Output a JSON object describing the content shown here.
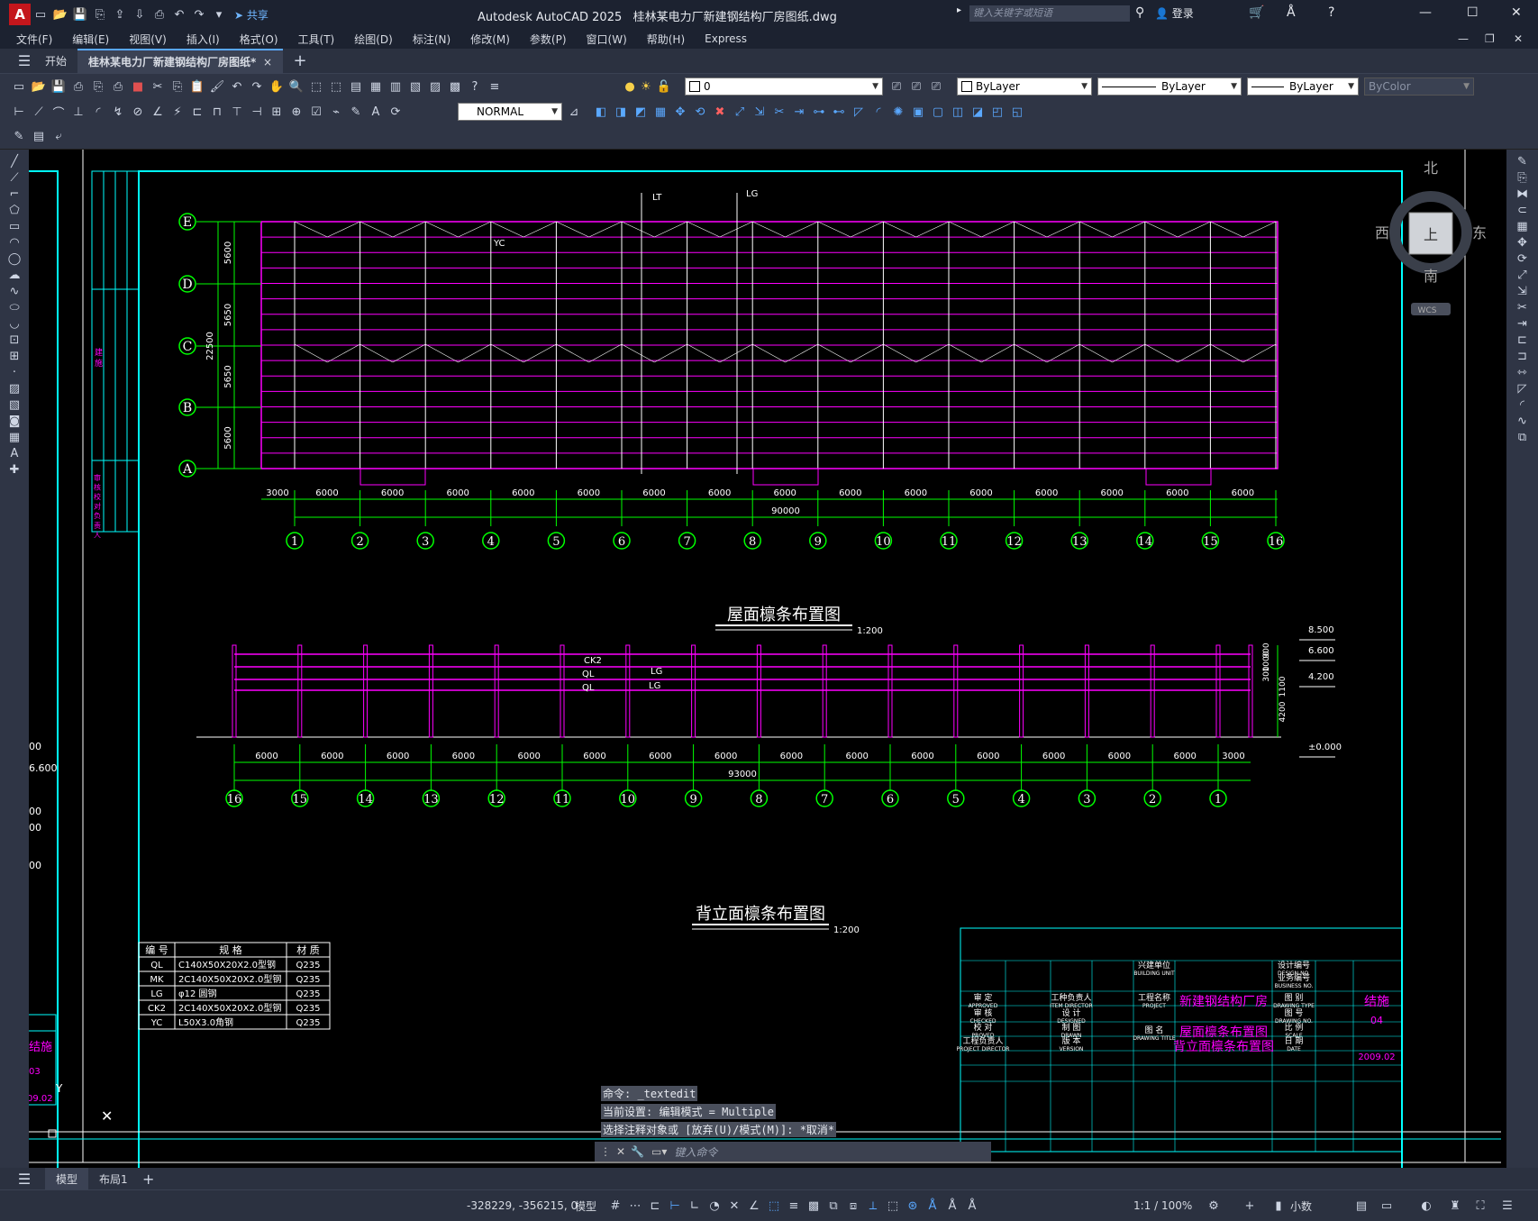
{
  "app": {
    "title": "Autodesk AutoCAD 2025",
    "file": "桂林某电力厂新建钢结构厂房图纸.dwg",
    "share": "共享",
    "search_placeholder": "键入关键字或短语",
    "login": "登录",
    "logo": "A"
  },
  "menu": [
    "文件(F)",
    "编辑(E)",
    "视图(V)",
    "插入(I)",
    "格式(O)",
    "工具(T)",
    "绘图(D)",
    "标注(N)",
    "修改(M)",
    "参数(P)",
    "窗口(W)",
    "帮助(H)",
    "Express"
  ],
  "doc_tabs": {
    "start": "开始",
    "active": "桂林某电力厂新建钢结构厂房图纸*",
    "close": "×",
    "add": "+"
  },
  "props": {
    "layer": "0",
    "color": "ByLayer",
    "linetype": "ByLayer",
    "lineweight": "ByLayer",
    "plotstyle": "ByColor",
    "dimstyle": "NORMAL"
  },
  "viewcube": {
    "north": "北",
    "south": "南",
    "east": "东",
    "west": "西",
    "face": "上",
    "wcs": "WCS"
  },
  "plan": {
    "title": "屋面檩条布置图",
    "scale": "1:200",
    "rows": [
      "E",
      "D",
      "C",
      "B",
      "A"
    ],
    "row_dims": [
      "5600",
      "5650",
      "5650",
      "5600"
    ],
    "total_row": "22500",
    "cols": [
      "1",
      "2",
      "3",
      "4",
      "5",
      "6",
      "7",
      "8",
      "9",
      "10",
      "11",
      "12",
      "13",
      "14",
      "15",
      "16"
    ],
    "first_span": "3000",
    "span": "6000",
    "total": "90000",
    "labels": {
      "lt": "LT",
      "lg": "LG",
      "yc": "YC"
    }
  },
  "elev": {
    "title": "背立面檩条布置图",
    "scale": "1:200",
    "cols": [
      "16",
      "15",
      "14",
      "13",
      "12",
      "11",
      "10",
      "9",
      "8",
      "7",
      "6",
      "5",
      "4",
      "3",
      "2",
      "1"
    ],
    "span": "6000",
    "last_span": "3000",
    "total": "93000",
    "levels": [
      "8.500",
      "6.600",
      "4.200",
      "±0.000"
    ],
    "vdims": [
      "900",
      "1000",
      "300",
      "1100",
      "4200"
    ],
    "labels": {
      "ck2": "CK2",
      "ql1": "QL",
      "ql2": "QL",
      "lg1": "LG",
      "lg2": "LG"
    }
  },
  "material_table": {
    "headers": [
      "编 号",
      "规 格",
      "材 质"
    ],
    "rows": [
      [
        "QL",
        "C140X50X20X2.0型钢",
        "Q235"
      ],
      [
        "MK",
        "2C140X50X20X2.0型钢",
        "Q235"
      ],
      [
        "LG",
        "φ12 圆钢",
        "Q235"
      ],
      [
        "CK2",
        "2C140X50X20X2.0型钢",
        "Q235"
      ],
      [
        "YC",
        "L50X3.0角钢",
        "Q235"
      ]
    ]
  },
  "title_block": {
    "approved": "审 定",
    "approved_en": "APPROVED",
    "checked": "审 核",
    "checked_en": "CHECKED",
    "proved": "校 对",
    "proved_en": "PROVED",
    "director": "工程负责人",
    "director_en": "PROJECT DIRECTOR",
    "item_director": "工种负责人",
    "item_director_en": "ITEM DIRECTOR",
    "designed": "设 计",
    "designed_en": "DESIGNED",
    "drawn": "制 图",
    "drawn_en": "DRAWN",
    "version": "版 本",
    "version_en": "VERSION",
    "building_unit": "兴建单位",
    "building_unit_en": "BUILDING UNIT",
    "project": "工程名称",
    "project_en": "PROJECT",
    "drawing_title": "图 名",
    "drawing_title_en": "DRAWING TITLE",
    "project_name": "新建钢结构厂房",
    "drawing_name1": "屋面檩条布置图",
    "drawing_name2": "背立面檩条布置图",
    "design_no": "设计编号",
    "design_no_en": "DESIGN NO.",
    "business_no": "业务编号",
    "business_no_en": "BUSINESS NO.",
    "drawing_type": "图 别",
    "drawing_type_en": "DRAWING TYPE",
    "drawing_no": "图 号",
    "drawing_no_en": "DRAWING NO.",
    "scale": "比 例",
    "scale_en": "SCALE",
    "date": "日 期",
    "date_en": "DATE",
    "type_val": "结施",
    "no_val": "04",
    "date_val": "2009.02"
  },
  "left_partial": {
    "v1": "00",
    "v2": "6.600",
    "v3": "00",
    "v4": "00",
    "v5": "00",
    "jieshi": "结施",
    "n03": "03",
    "d": "09.02",
    "y": "Y",
    "tall": "建 施",
    "tall2": "审 核 校 对 负 责 人"
  },
  "command": {
    "h1": "命令: _textedit",
    "h2": "当前设置: 编辑模式 = Multiple",
    "h3": "选择注释对象或 [放弃(U)/模式(M)]: *取消*",
    "placeholder": "键入命令"
  },
  "layout_tabs": [
    "模型",
    "布局1"
  ],
  "status": {
    "coords": "-328229, -356215, 0",
    "model": "模型",
    "scale": "1:1 / 100%",
    "units": "小数"
  }
}
